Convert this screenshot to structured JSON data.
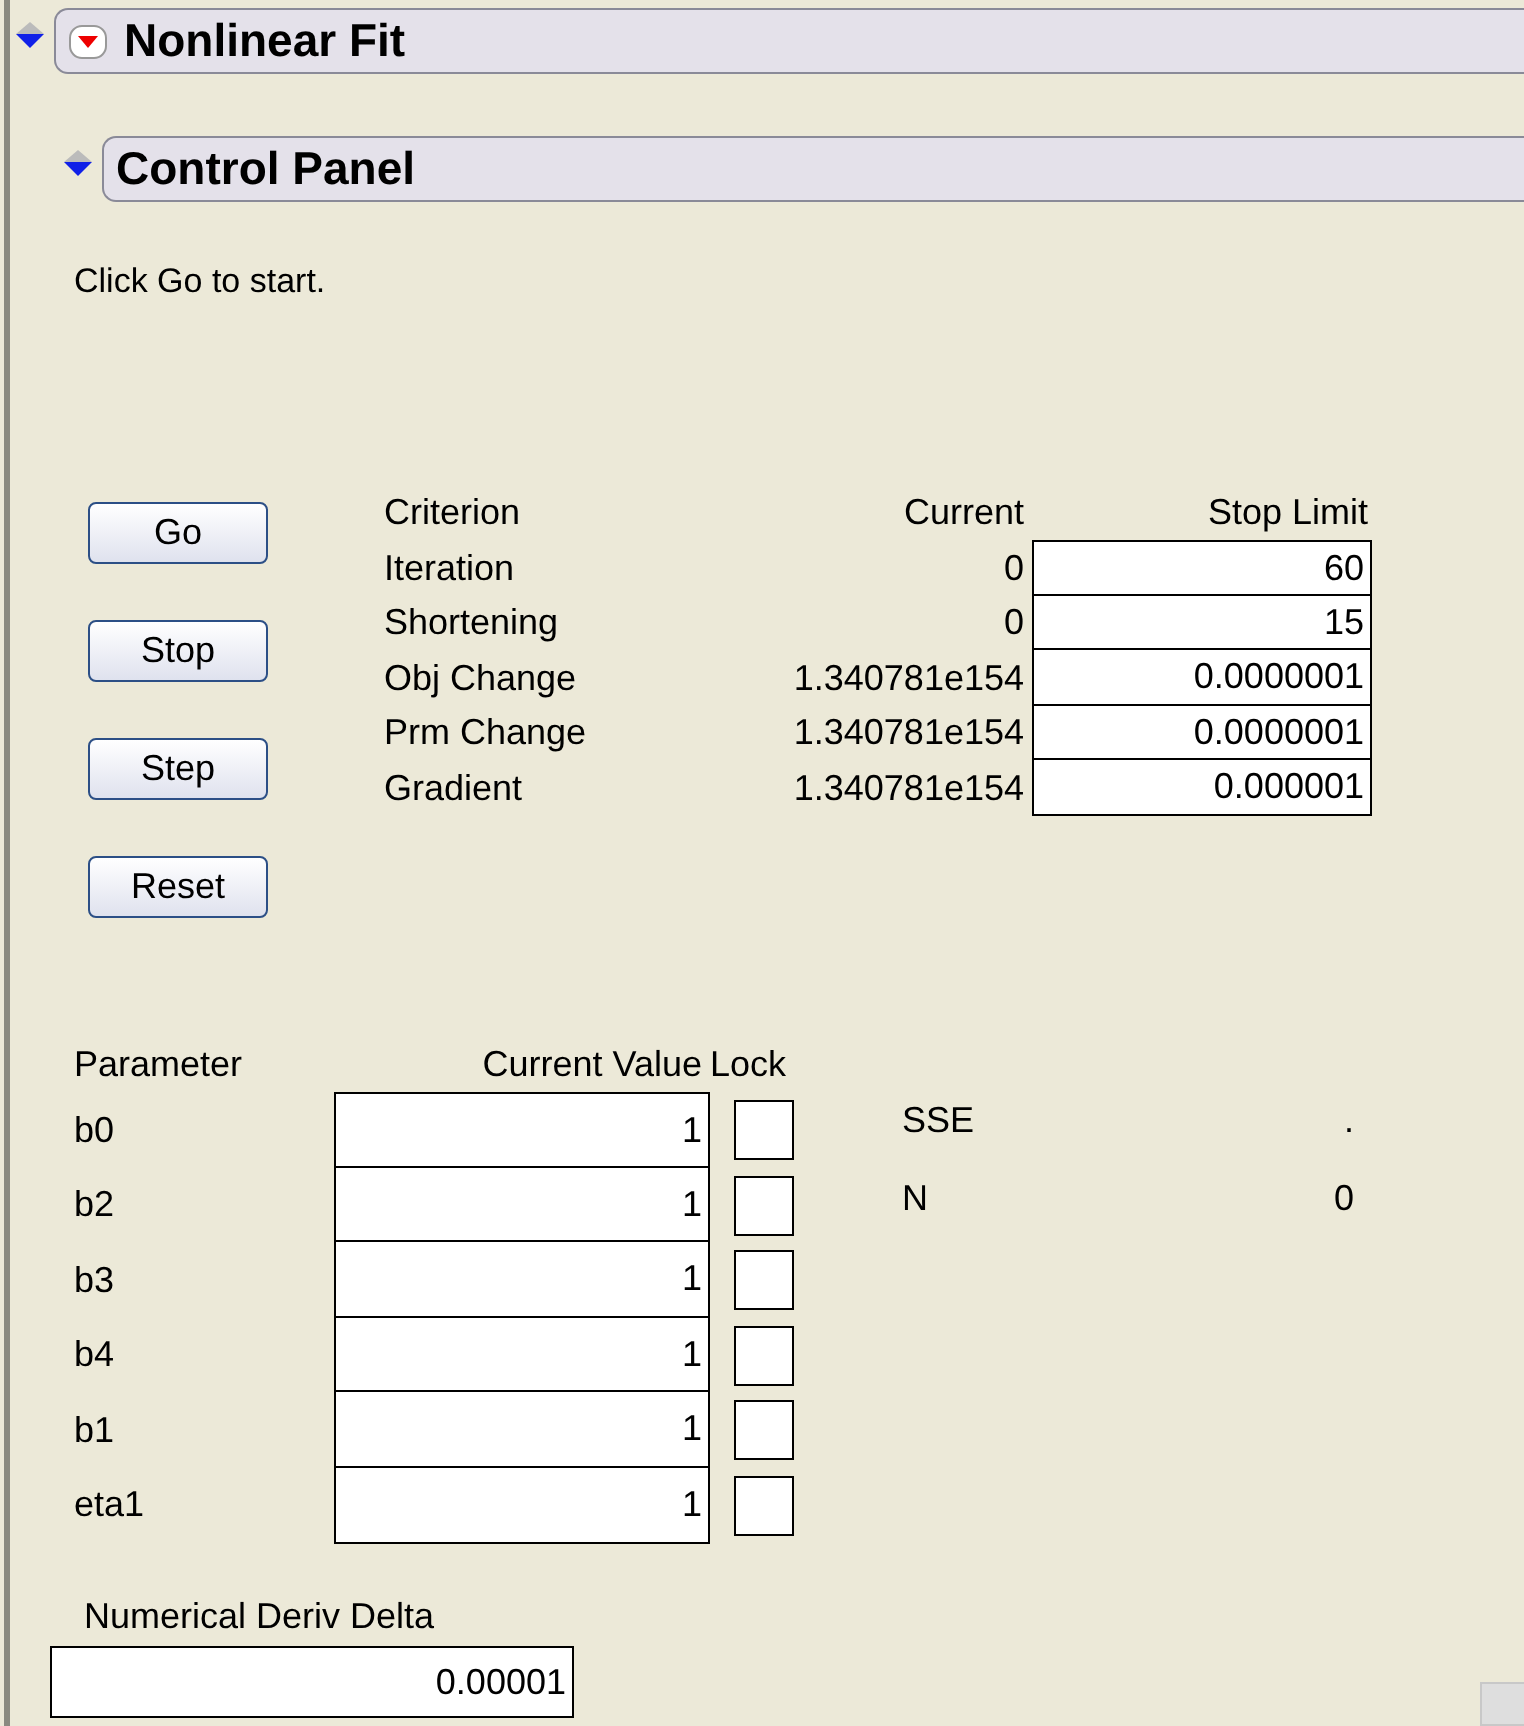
{
  "outline": {
    "title": "Nonlinear Fit",
    "expanded": true,
    "panel": {
      "title": "Control Panel",
      "expanded": true,
      "message": "Click Go to start.",
      "buttons": [
        "Go",
        "Stop",
        "Step",
        "Reset"
      ],
      "criteria": {
        "columns": [
          "Criterion",
          "Current",
          "Stop Limit"
        ],
        "rows": [
          {
            "name": "Iteration",
            "current": "0",
            "stop_limit": "60"
          },
          {
            "name": "Shortening",
            "current": "0",
            "stop_limit": "15"
          },
          {
            "name": "Obj Change",
            "current": "1.340781e154",
            "stop_limit": "0.0000001"
          },
          {
            "name": "Prm Change",
            "current": "1.340781e154",
            "stop_limit": "0.0000001"
          },
          {
            "name": "Gradient",
            "current": "1.340781e154",
            "stop_limit": "0.000001"
          }
        ]
      },
      "parameters": {
        "columns": [
          "Parameter",
          "Current Value",
          "Lock"
        ],
        "rows": [
          {
            "name": "b0",
            "value": "1",
            "locked": false
          },
          {
            "name": "b2",
            "value": "1",
            "locked": false
          },
          {
            "name": "b3",
            "value": "1",
            "locked": false
          },
          {
            "name": "b4",
            "value": "1",
            "locked": false
          },
          {
            "name": "b1",
            "value": "1",
            "locked": false
          },
          {
            "name": "eta1",
            "value": "1",
            "locked": false
          }
        ]
      },
      "stats": [
        {
          "label": "SSE",
          "value": "."
        },
        {
          "label": "N",
          "value": "0"
        }
      ],
      "deriv_delta": {
        "label": "Numerical Deriv Delta",
        "value": "0.00001"
      }
    }
  }
}
